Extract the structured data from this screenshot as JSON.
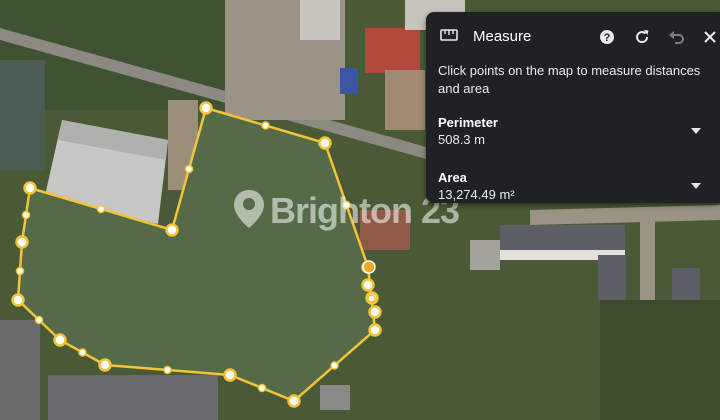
{
  "panel": {
    "title": "Measure",
    "instructions": "Click points on the map to measure distances and area",
    "perimeter_label": "Perimeter",
    "perimeter_value": "508.3 m",
    "area_label": "Area",
    "area_value": "13,274.49 m²"
  },
  "icons": {
    "ruler": "ruler-icon",
    "help": "help-icon",
    "refresh": "refresh-icon",
    "undo": "undo-icon",
    "close": "close-icon",
    "dropdown": "chevron-down-icon"
  },
  "watermark": {
    "text": "Brighton 23"
  },
  "colors": {
    "measure_line": "#f3c338",
    "panel_bg": "#202124",
    "active_point": "#f5a623"
  }
}
